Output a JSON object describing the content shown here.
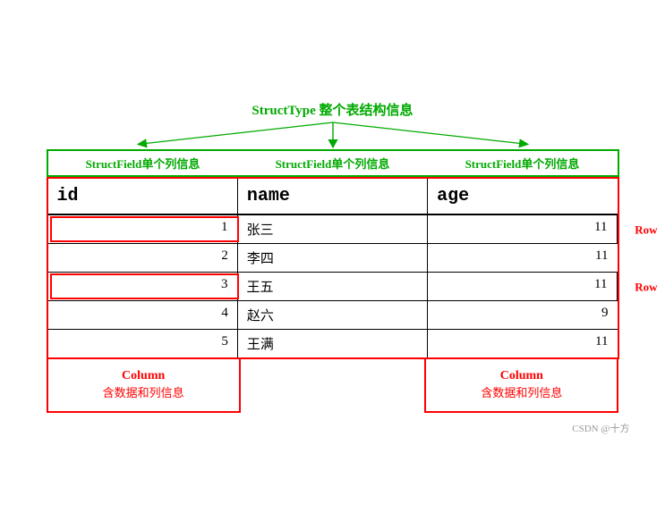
{
  "struct_type": {
    "label": "StructType 整个表结构信息"
  },
  "struct_fields": [
    {
      "label": "StructField单个列信息"
    },
    {
      "label": "StructField单个列信息"
    },
    {
      "label": "StructField单个列信息"
    }
  ],
  "table": {
    "headers": [
      "id",
      "name",
      "age"
    ],
    "rows": [
      {
        "id": "1",
        "name": "张三",
        "age": "11",
        "highlight_row": true
      },
      {
        "id": "2",
        "name": "李四",
        "age": "11",
        "highlight_row": false
      },
      {
        "id": "3",
        "name": "王五",
        "age": "11",
        "highlight_row": true
      },
      {
        "id": "4",
        "name": "赵六",
        "age": "9",
        "highlight_row": false
      },
      {
        "id": "5",
        "name": "王满",
        "age": "11",
        "highlight_row": false
      }
    ]
  },
  "row_labels": [
    {
      "text": "Row（含数据）",
      "row_index": 0
    },
    {
      "text": "Row（含数据）",
      "row_index": 2
    }
  ],
  "column_labels": [
    {
      "title": "Column",
      "sub": "含数据和列信息",
      "visible": true
    },
    {
      "title": "",
      "sub": "",
      "visible": false
    },
    {
      "title": "Column",
      "sub": "含数据和列信息",
      "visible": true
    }
  ],
  "watermark": "CSDN @十方"
}
